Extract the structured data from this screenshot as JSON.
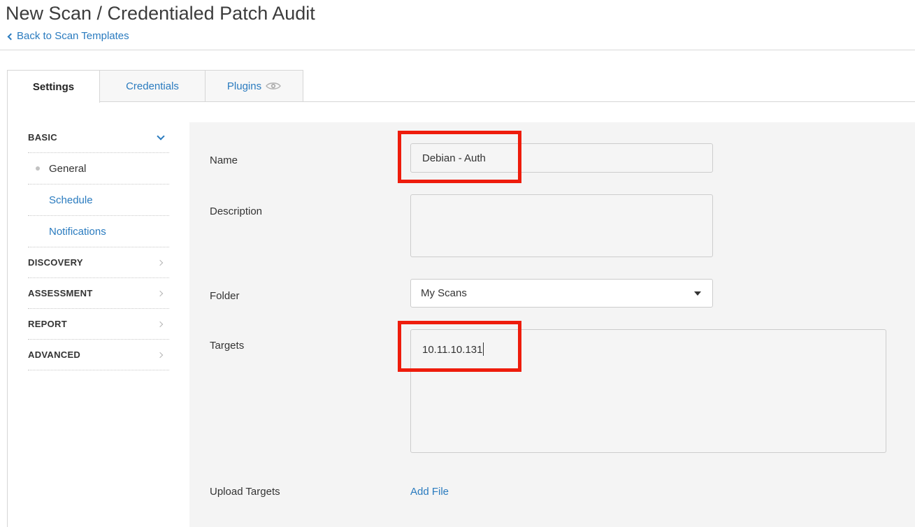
{
  "header": {
    "title": "New Scan / Credentialed Patch Audit",
    "back_label": "Back to Scan Templates"
  },
  "tabs": [
    {
      "label": "Settings",
      "active": true
    },
    {
      "label": "Credentials",
      "active": false
    },
    {
      "label": "Plugins",
      "active": false,
      "icon": "eye-icon"
    }
  ],
  "sidebar": {
    "sections": [
      {
        "label": "BASIC",
        "expanded": true,
        "icon": "caret-down-icon"
      },
      {
        "label": "DISCOVERY",
        "icon": "caret-right-icon"
      },
      {
        "label": "ASSESSMENT",
        "icon": "caret-right-icon"
      },
      {
        "label": "REPORT",
        "icon": "caret-right-icon"
      },
      {
        "label": "ADVANCED",
        "icon": "caret-right-icon"
      }
    ],
    "basic_items": [
      {
        "label": "General",
        "current": true
      },
      {
        "label": "Schedule",
        "current": false
      },
      {
        "label": "Notifications",
        "current": false
      }
    ]
  },
  "form": {
    "name_label": "Name",
    "name_value": "Debian - Auth",
    "description_label": "Description",
    "description_value": "",
    "folder_label": "Folder",
    "folder_value": "My Scans",
    "targets_label": "Targets",
    "targets_value": "10.11.10.131",
    "upload_label": "Upload Targets",
    "add_file_label": "Add File"
  },
  "colors": {
    "link": "#2a7bbf",
    "highlight": "#ee1c0c",
    "panel_bg": "#f4f4f4"
  }
}
